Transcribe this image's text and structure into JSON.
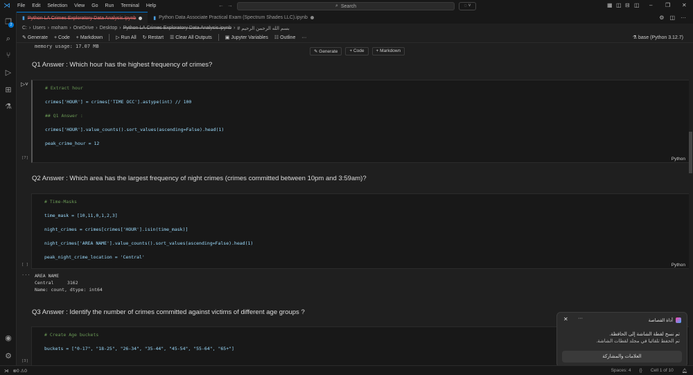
{
  "menu": [
    "File",
    "Edit",
    "Selection",
    "View",
    "Go",
    "Run",
    "Terminal",
    "Help"
  ],
  "search_label": "Search",
  "tabs": [
    {
      "label": "Python LA Crimes Exploratory Data Analysis.ipynb",
      "modified": true
    },
    {
      "label": "Python Data Associate Practical Exam (Spectrum Shades LLC).ipynb",
      "modified": true
    }
  ],
  "breadcrumb": [
    "C:",
    "Users",
    "moham",
    "OneDrive",
    "Desktop",
    "Python LA Crimes Exploratory Data Analysis.ipynb",
    "# بسم الله الرحمن الرحيم"
  ],
  "toolbar": {
    "generate": "Generate",
    "code": "Code",
    "markdown": "Markdown",
    "run_all": "Run All",
    "restart": "Restart",
    "clear": "Clear All Outputs",
    "variables": "Jupyter Variables",
    "outline": "Outline",
    "more": "···"
  },
  "kernel": "base (Python 3.12.7)",
  "explorer_badge": "2",
  "notebook": {
    "memory_line": "memory usage: 17.07 MB",
    "float": {
      "generate": "Generate",
      "code": "Code",
      "markdown": "Markdown"
    },
    "q1": "Q1 Answer : Which hour has the highest frequency of crimes?",
    "cell1": {
      "lines": [
        "# Extract hour",
        "crimes['HOUR'] = crimes['TIME OCC'].astype(int) // 100",
        "## Q1 Answer :",
        "crimes['HOUR'].value_counts().sort_values(ascending=False).head(1)",
        "peak_crime_hour = 12"
      ],
      "exec": "[7]",
      "lang": "Python"
    },
    "q2": "Q2 Answer : Which area has the largest frequency of night crimes (crimes committed between 10pm and 3:59am)?",
    "cell2": {
      "lines": [
        "# Time-Masks",
        "time_mask = [10,11,0,1,2,3]",
        "night_crimes = crimes[crimes['HOUR'].isin(time_mask)]",
        "night_crimes['AREA NAME'].value_counts().sort_values(ascending=False).head(1)",
        "peak_night_crime_location = 'Central'"
      ],
      "exec": "[ ]",
      "lang": "Python",
      "output": "AREA NAME\nCentral     3162\nName: count, dtype: int64"
    },
    "q3": "Q3 Answer : Identify the number of crimes committed against victims of different age groups ?",
    "cell3": {
      "lines": [
        "# Create Age buckets",
        "buckets = [\"0-17\", \"18-25\", \"26-34\", \"35-44\", \"45-54\", \"55-64\", \"65+\"]"
      ],
      "exec": "[3]"
    }
  },
  "notification": {
    "app": "أداة القصاصة",
    "line1": "تم نسخ لقطة الشاشة إلى الحافظة.",
    "line2": "تم الحفظ تلقائيا في مجلد لقطات الشاشة.",
    "button": "العلامات والمشاركة"
  },
  "status": {
    "errors": "0",
    "warnings": "0",
    "spaces": "Spaces: 4",
    "cell": "Cell 1 of 10"
  }
}
